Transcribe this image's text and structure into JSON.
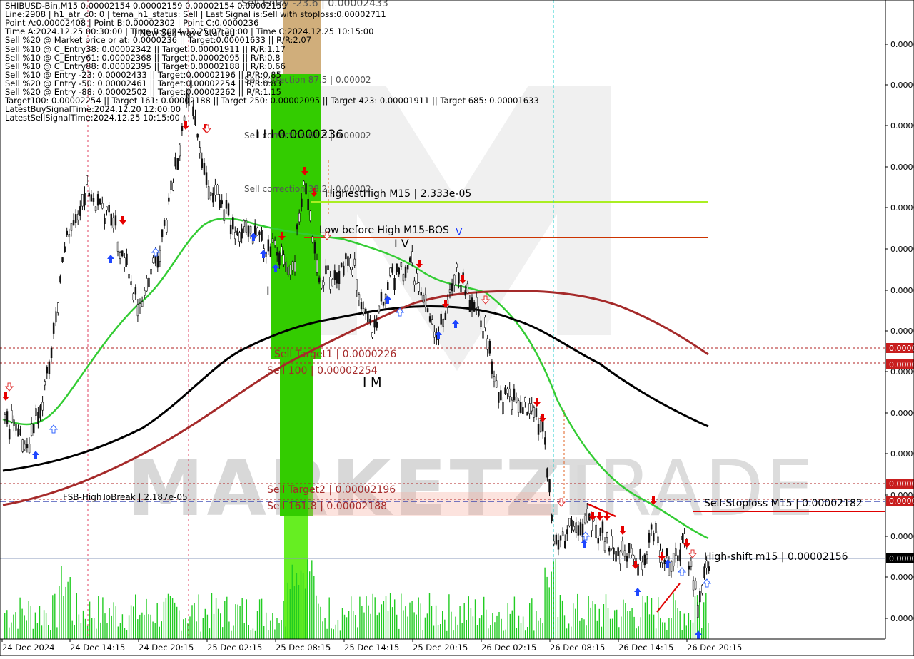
{
  "header": {
    "lines": [
      "SHIBUSD-Bin,M15  0.00002154 0.00002159 0.00002154 0.00002159",
      "Line:2908 | h1_atr_c0: 0 | tema_h1_status: Sell | Last Signal is:Sell with stoploss:0.00002711",
      "Point A:0.00002408 | Point B:0.00002302 | Point C:0.0000236",
      "Time A:2024.12.25 00:30:00 | Time B:2024.12.25 07:30:00 | Time C:2024.12.25 10:15:00",
      "Sell %20 @ Market price or at: 0.0000236 || Target:0.00001633 || R/R:2.07",
      "Sell %10 @ C_Entry38: 0.00002342 || Target:0.00001911 || R/R:1.17",
      "Sell %10 @ C_Entry61: 0.00002368 || Target:0.00002095 || R/R:0.8",
      "Sell %10 @ C_Entry88: 0.00002395 || Target:0.00002188 || R/R:0.66",
      "Sell %10 @ Entry -23: 0.00002433 || Target:0.00002196 || R/R:0.85",
      "Sell %20 @ Entry -50: 0.00002461 || Target:0.00002254 || R/R:0.83",
      "Sell %20 @ Entry -88: 0.00002502 || Target:0.00002262 || R/R:1.15",
      "Target100: 0.00002254 || Target 161: 0.00002188 || Target 250: 0.00002095 || Target 423: 0.00001911 || Target 685: 0.00001633",
      "LatestBuySignalTime:2024.12.20 12:00:00",
      "LatestSellSignalTime:2024.12.25 10:15:00"
    ]
  },
  "annotations": {
    "sell_entry_top": "Sell Entry -23.6 | 0.00002433",
    "new_sell_wave": "I New Sell wave started",
    "sell_correction_875": "Sell correction 87.5 | 0.00002",
    "sell_correction_618": "Sell correction 61.8 | 0.00002",
    "sell_correction_382": "Sell correction 38.2 | 0.00002",
    "point_c_label": "I I I 0.0000236",
    "highest_high": "HighestHigh   M15 | 2.333e-05",
    "low_before_high": "Low before High   M15-BOS",
    "sell_target1": "Sell Target1 | 0.0000226",
    "sell_100": "Sell 100 | 0.00002254",
    "sell_target2": "Sell Target2 | 0.00002196",
    "sell_1618": "Sell 161.8 | 0.00002188",
    "fsb_high": "FSB-HighToBreak | 2.187e-05",
    "sell_stoploss": "Sell-Stoploss M15 | 0.00002182",
    "high_shift": "High-shift m15 | 0.00002156",
    "tv_mark": "I V",
    "v_mark": "V",
    "i_mark": "I",
    "im_mark": "I M",
    "iii_mark": "I I I"
  },
  "watermark": {
    "left": "MARKETZI",
    "right": "TRADE"
  },
  "price_axis": {
    "labels": [
      "0.0000",
      "0.0000",
      "0.0000",
      "0.0000",
      "0.0000",
      "0.0000",
      "0.0000",
      "0.0000",
      "0.0000",
      "0.0000",
      "0.0000",
      "0.0000",
      "0.0000",
      "0.0000",
      "0.0000"
    ],
    "tags": [
      "0.0000",
      "0.0000",
      "0.0000",
      "0.0000",
      "0.0000"
    ]
  },
  "time_axis": {
    "labels": [
      "24 Dec 2024",
      "24 Dec 14:15",
      "24 Dec 20:15",
      "25 Dec 02:15",
      "25 Dec 08:15",
      "25 Dec 14:15",
      "25 Dec 20:15",
      "26 Dec 02:15",
      "26 Dec 08:15",
      "26 Dec 14:15",
      "26 Dec 20:15"
    ]
  },
  "colors": {
    "bull": "#1b1b1b",
    "ma_green": "#33cc33",
    "ma_black": "#000000",
    "ma_brown": "#a52a2a",
    "zone_green": "#33cc00",
    "zone_tan": "#c8a064",
    "buy_arrow": "#1e46ff",
    "sell_arrow": "#e60000",
    "highest_high_line": "#aaee22",
    "bos_line": "#cc3300",
    "stoploss_line": "#e00000",
    "volume": "#22cc22"
  }
}
